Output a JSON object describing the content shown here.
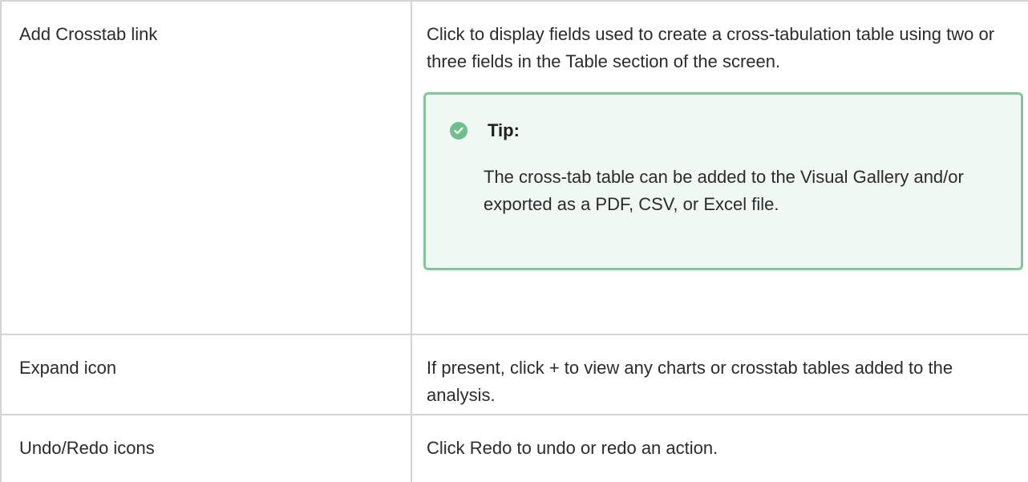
{
  "rows": [
    {
      "term": "Add Crosstab link",
      "description": "Click to display fields used to create a cross-tabulation table using two or three fields in the Table section of the screen.",
      "tip": {
        "title": "Tip:",
        "body": "The cross-tab table can be added to the Visual Gallery and/or exported as a PDF, CSV, or Excel file.",
        "icon": "check-circle-icon",
        "accent_color": "#82c79a",
        "background_color": "#eff8f2"
      }
    },
    {
      "term": "Expand icon",
      "description": "If present, click + to view any charts or crosstab tables added to the analysis."
    },
    {
      "term": "Undo/Redo icons",
      "description": "Click Redo to undo or redo an action."
    }
  ]
}
